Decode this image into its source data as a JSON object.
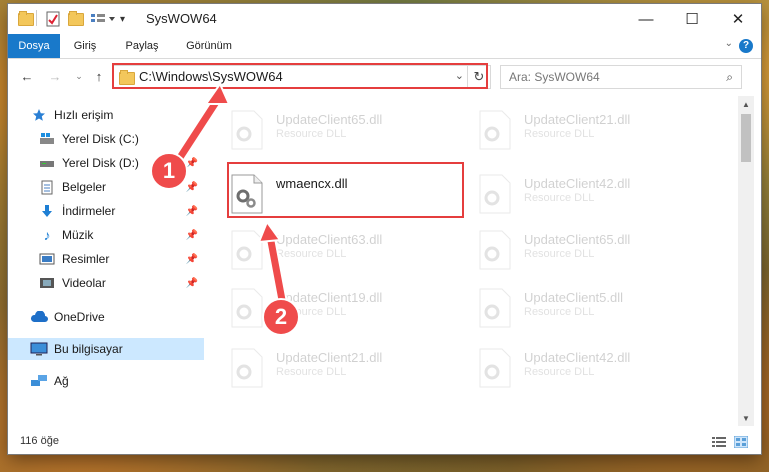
{
  "window": {
    "title": "SysWOW64",
    "minimize_glyph": "—",
    "maximize_glyph": "☐",
    "close_glyph": "✕"
  },
  "ribbon": {
    "tabs": [
      "Dosya",
      "Giriş",
      "Paylaş",
      "Görünüm"
    ]
  },
  "address": {
    "path": "C:\\Windows\\SysWOW64",
    "search_placeholder": "Ara: SysWOW64"
  },
  "sidebar": {
    "items": [
      {
        "label": "Hızlı erişim",
        "icon": "star-icon",
        "pinned": false
      },
      {
        "label": "Yerel Disk (C:)",
        "icon": "drive-icon",
        "pinned": true
      },
      {
        "label": "Yerel Disk (D:)",
        "icon": "drive-icon",
        "pinned": true
      },
      {
        "label": "Belgeler",
        "icon": "documents-icon",
        "pinned": true
      },
      {
        "label": "İndirmeler",
        "icon": "download-icon",
        "pinned": true
      },
      {
        "label": "Müzik",
        "icon": "music-icon",
        "pinned": true
      },
      {
        "label": "Resimler",
        "icon": "pictures-icon",
        "pinned": true
      },
      {
        "label": "Videolar",
        "icon": "video-icon",
        "pinned": true
      },
      {
        "label": "OneDrive",
        "icon": "cloud-icon",
        "pinned": false
      },
      {
        "label": "Bu bilgisayar",
        "icon": "computer-icon",
        "pinned": false,
        "selected": true
      },
      {
        "label": "Ağ",
        "icon": "network-icon",
        "pinned": false
      }
    ]
  },
  "files": {
    "left": [
      {
        "name": "UpdateClient65.dll",
        "type": "Resource DLL",
        "faded": true
      },
      {
        "name": "wmaencx.dll",
        "type": "",
        "faded": false
      },
      {
        "name": "UpdateClient63.dll",
        "type": "Resource DLL",
        "faded": true
      },
      {
        "name": "UpdateClient19.dll",
        "type": "Resource DLL",
        "faded": true
      },
      {
        "name": "UpdateClient21.dll",
        "type": "Resource DLL",
        "faded": true
      }
    ],
    "right": [
      {
        "name": "UpdateClient21.dll",
        "type": "Resource DLL",
        "faded": true
      },
      {
        "name": "UpdateClient42.dll",
        "type": "Resource DLL",
        "faded": true
      },
      {
        "name": "UpdateClient65.dll",
        "type": "Resource DLL",
        "faded": true
      },
      {
        "name": "UpdateClient5.dll",
        "type": "Resource DLL",
        "faded": true
      },
      {
        "name": "UpdateClient42.dll",
        "type": "Resource DLL",
        "faded": true
      }
    ]
  },
  "status": {
    "count": "116 öğe"
  },
  "annotations": {
    "callout_1": "1",
    "callout_2": "2",
    "accent_color": "#ef4b4b"
  },
  "colors": {
    "file_tab": "#1979ca",
    "selected_nav": "#cce8ff",
    "highlight": "#e53e3e"
  }
}
